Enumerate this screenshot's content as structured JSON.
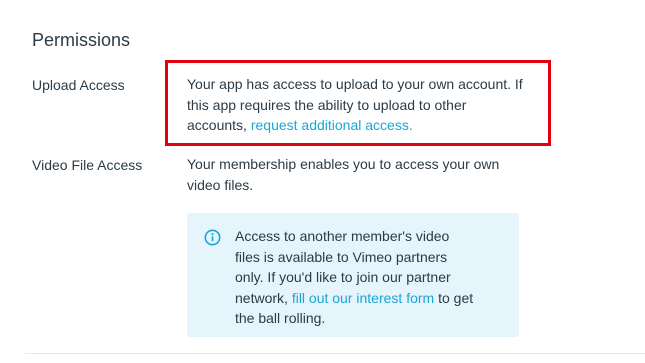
{
  "section": {
    "title": "Permissions"
  },
  "upload_access": {
    "label": "Upload Access",
    "text": "Your app has access to upload to your own account. If this app requires the ability to upload to other accounts, ",
    "link_text": "request additional access."
  },
  "video_file_access": {
    "label": "Video File Access",
    "text": "Your membership enables you to access your own video files."
  },
  "info_box": {
    "icon": "info-circle-icon",
    "text_before": "Access to another member's video files is available to Vimeo partners only. If you'd like to join our partner network, ",
    "link_text": "fill out our interest form",
    "text_after": " to get the ball rolling."
  },
  "colors": {
    "link": "#1ba6d8",
    "highlight_border": "#e3000f",
    "info_background": "#e6f4fb",
    "text": "#2b3b47"
  }
}
